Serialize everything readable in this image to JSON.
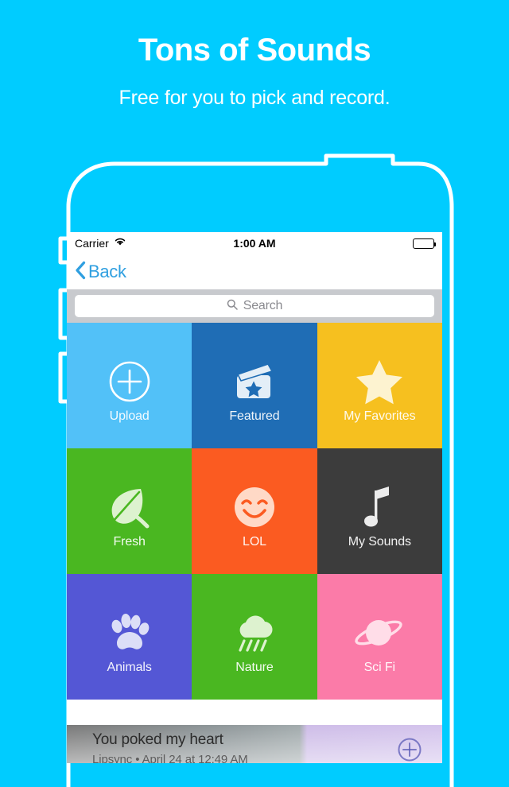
{
  "promo": {
    "title": "Tons of Sounds",
    "subtitle": "Free for you to pick and record."
  },
  "colors": {
    "background": "#00ccff",
    "frame": "#ffffff",
    "tint": "#2f9fe0",
    "searchbar": "#c8cace"
  },
  "statusbar": {
    "carrier": "Carrier",
    "wifi_icon": "wifi-icon",
    "time": "1:00 AM",
    "battery_icon": "battery-icon"
  },
  "navbar": {
    "back_label": "Back",
    "back_icon": "chevron-left-icon"
  },
  "search": {
    "placeholder": "Search",
    "value": "",
    "icon": "search-icon"
  },
  "grid": {
    "tiles": [
      {
        "label": "Upload",
        "icon": "plus-circle-icon",
        "bg": "#52c1f8",
        "fg": "#ffffff"
      },
      {
        "label": "Featured",
        "icon": "clapperboard-icon",
        "bg": "#1f6db5",
        "fg": "#e3eef7"
      },
      {
        "label": "My Favorites",
        "icon": "star-icon",
        "bg": "#f6c01f",
        "fg": "#fdf3d0"
      },
      {
        "label": "Fresh",
        "icon": "leaf-icon",
        "bg": "#4ab721",
        "fg": "#ddf2cf"
      },
      {
        "label": "LOL",
        "icon": "smiley-icon",
        "bg": "#fb5b21",
        "fg": "#ffd9c6"
      },
      {
        "label": "My Sounds",
        "icon": "music-note-icon",
        "bg": "#3c3c3c",
        "fg": "#ececec"
      },
      {
        "label": "Animals",
        "icon": "paw-icon",
        "bg": "#5457d5",
        "fg": "#dcdef7"
      },
      {
        "label": "Nature",
        "icon": "rain-cloud-icon",
        "bg": "#4ab721",
        "fg": "#ddf2cf"
      },
      {
        "label": "Sci Fi",
        "icon": "planet-icon",
        "bg": "#fb7ba8",
        "fg": "#ffdde8"
      }
    ]
  },
  "feed_card": {
    "title": "You poked my heart",
    "meta": "Lipsync  •  April 24 at 12:49 AM",
    "add_icon": "add-circle-icon"
  }
}
